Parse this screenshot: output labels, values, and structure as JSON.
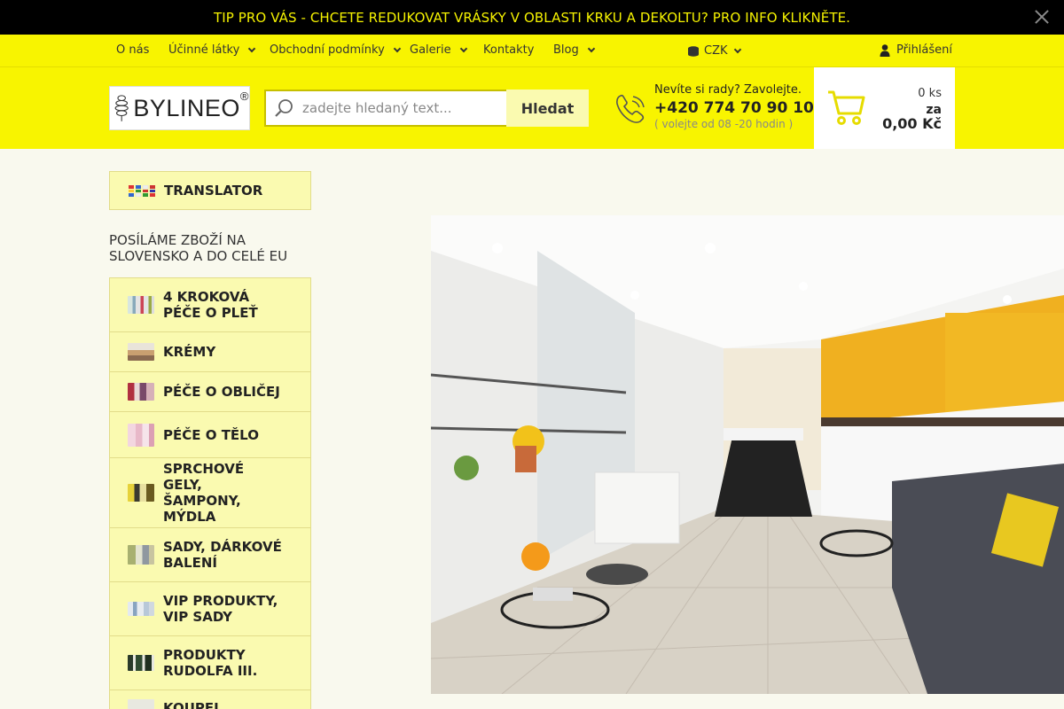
{
  "promo": {
    "text": "TIP PRO VÁS - CHCETE REDUKOVAT VRÁSKY V OBLASTI KRKU A DEKOLTU? PRO INFO KLIKNĚTE."
  },
  "topnav": {
    "about": "O nás",
    "ingredients": "Účinné látky",
    "terms": "Obchodní podmínky",
    "gallery": "Galerie",
    "contacts": "Kontakty",
    "blog": "Blog",
    "currency": "CZK",
    "login": "Přihlášení"
  },
  "header": {
    "logo_text": "BYLINEO",
    "logo_mark": "®",
    "search_placeholder": "zadejte hledaný text...",
    "search_button": "Hledat",
    "help_line": "Nevíte si rady? Zavolejte.",
    "phone": "+420 774 70 90 10",
    "hours": "( volejte od 08 -20 hodin )"
  },
  "cart": {
    "count": "0 ks",
    "for": "za",
    "price": "0,00 Kč"
  },
  "sidebar": {
    "translator": "TRANSLATOR",
    "shipping_note": "POSÍLÁME ZBOŽÍ NA SLOVENSKO A DO CELÉ EU",
    "categories": [
      {
        "label": "4 KROKOVÁ PÉČE O PLEŤ"
      },
      {
        "label": "KRÉMY"
      },
      {
        "label": "PÉČE O OBLIČEJ"
      },
      {
        "label": "PÉČE O TĚLO"
      },
      {
        "label": "SPRCHOVÉ GELY, ŠAMPONY, MÝDLA"
      },
      {
        "label": "SADY, DÁRKOVÉ BALENÍ"
      },
      {
        "label": "VIP PRODUKTY, VIP SADY"
      },
      {
        "label": "PRODUKTY RUDOLFA III."
      },
      {
        "label": "KOUPEL"
      }
    ]
  },
  "colors": {
    "brand_yellow": "#f8f400",
    "sidebar_bg": "#fafab0",
    "promo_text": "#f5f200"
  },
  "icons": [
    "close-icon",
    "chevron-down-icon",
    "coins-icon",
    "user-icon",
    "search-icon",
    "phone-icon",
    "cart-icon"
  ]
}
